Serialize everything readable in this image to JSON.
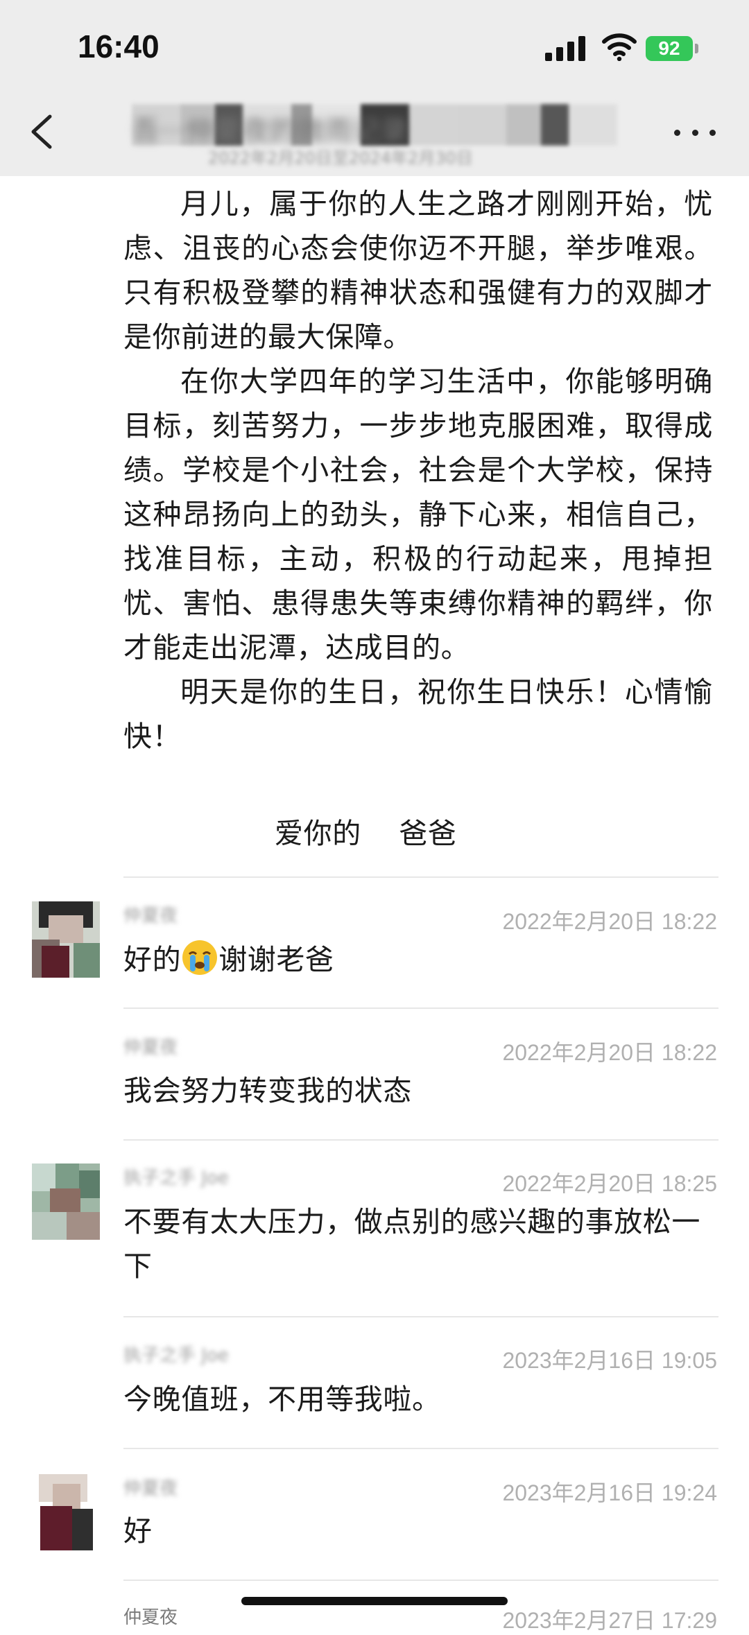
{
  "status_bar": {
    "time": "16:40",
    "battery": "92",
    "battery_color": "#34c759"
  },
  "nav": {
    "back_icon": "chevron-left-icon",
    "more_icon": "ellipsis-icon",
    "title_blurred": "吾···仲夏夜的微雨记录",
    "subtitle_blurred": "2022年2月20日至2024年2月30日"
  },
  "article": {
    "paragraphs": [
      "月儿，属于你的人生之路才刚刚开始，忧虑、沮丧的心态会使你迈不开腿，举步唯艰。只有积极登攀的精神状态和强健有力的双脚才是你前进的最大保障。",
      "在你大学四年的学习生活中，你能够明确目标，刻苦努力，一步步地克服困难，取得成绩。学校是个小社会，社会是个大学校，保持这种昂扬向上的劲头，静下心来，相信自己，找准目标，主动，积极的行动起来，甩掉担忧、害怕、患得患失等束缚你精神的羁绊，你才能走出泥潭，达成目的。",
      "明天是你的生日，祝你生日快乐！心情愉快！"
    ],
    "signoff": "爱你的    爸爸"
  },
  "comments": [
    {
      "name": "仲夏夜",
      "date": "2022年2月20日 18:22",
      "text_before": "好的",
      "emoji": "crying-face",
      "text_after": "谢谢老爸",
      "has_avatar": true
    },
    {
      "name": "仲夏夜",
      "date": "2022年2月20日 18:22",
      "text": "我会努力转变我的状态",
      "has_avatar": false
    },
    {
      "name": "执子之手 Joe",
      "date": "2022年2月20日 18:25",
      "text": "不要有太大压力，做点别的感兴趣的事放松一下",
      "has_avatar": true
    },
    {
      "name": "执子之手 Joe",
      "date": "2023年2月16日 19:05",
      "text": "今晚值班，不用等我啦。",
      "has_avatar": false
    },
    {
      "name": "仲夏夜",
      "date": "2023年2月16日 19:24",
      "text": "好",
      "has_avatar": true
    },
    {
      "name": "仲夏夜",
      "date": "2023年2月27日 17:29",
      "text": "",
      "has_avatar": false
    }
  ]
}
